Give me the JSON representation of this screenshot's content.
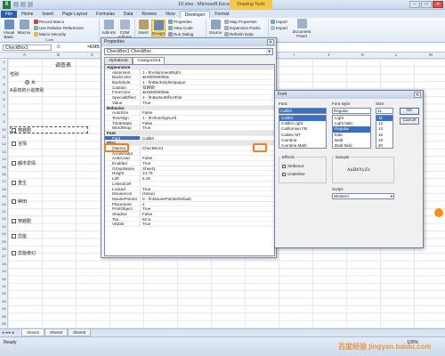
{
  "window": {
    "app_icon": "X",
    "title": "10.xlsx - Microsoft Excel",
    "context_tab": "Drawing Tools",
    "controls": [
      "–",
      "□",
      "✕"
    ]
  },
  "ribbon_tabs": [
    "File",
    "Home",
    "Insert",
    "Page Layout",
    "Formulas",
    "Data",
    "Review",
    "View",
    "Developer",
    "Format"
  ],
  "ribbon": {
    "visual_basic": "Visual Basic",
    "macros": "Macros",
    "record_macro": "Record Macro",
    "relative_refs": "Use Relative References",
    "macro_security": "Macro Security",
    "code_group": "Code",
    "add_ins": "Add-Ins",
    "com_add_ins": "COM Add-Ins",
    "insert": "Insert",
    "design": "Design",
    "properties": "Properties",
    "view_code": "View Code",
    "run_dialog": "Run Dialog",
    "source": "Source",
    "map_properties": "Map Properties",
    "expansion_packs": "Expansion Packs",
    "refresh_data": "Refresh Data",
    "import": "Import",
    "export": "Export",
    "document_panel": "Document Panel"
  },
  "formula_bar": {
    "name_box": "CheckBox1",
    "fx": "fx",
    "value": "=EMB"
  },
  "sheet": {
    "columns": [
      "A",
      "B",
      "C",
      "D",
      "E",
      "F",
      "G",
      "H",
      "I",
      "J",
      "K",
      "L",
      "M"
    ],
    "rows": [
      "1",
      "2",
      "3",
      "4",
      "5",
      "6",
      "7",
      "8",
      "9",
      "10",
      "11",
      "12",
      "13",
      "14",
      "15",
      "16",
      "17",
      "18",
      "19",
      "20",
      "21",
      "22",
      "23",
      "24",
      "25",
      "26",
      "27",
      "28",
      "29",
      "30",
      "31",
      "32",
      "33",
      "34",
      "35",
      "36"
    ],
    "title": "调查表",
    "gender_label": "性别",
    "radio_female": "女",
    "hobbies_prompt": "A喜欢的小说类别",
    "checkboxes": [
      "穿越剧",
      "言情",
      "都市爱情",
      "重生",
      "种田",
      "穿越剧",
      "异能",
      "异能奇幻"
    ]
  },
  "sheet_tabs": [
    "Sheet1",
    "Sheet2",
    "Sheet3"
  ],
  "status": {
    "ready": "Ready",
    "zoom": "100%"
  },
  "properties": {
    "title": "Properties",
    "object": "CheckBox1 CheckBox",
    "tabs": [
      "Alphabetic",
      "Categorized"
    ],
    "rows": [
      {
        "cat": "Appearance"
      },
      {
        "name": "Alignment",
        "value": "1 - fmAlignmentRight"
      },
      {
        "name": "BackColor",
        "value": "&H80000005&"
      },
      {
        "name": "BackStyle",
        "value": "1 - fmBackStyleOpaque"
      },
      {
        "name": "Caption",
        "value": "穿越剧"
      },
      {
        "name": "ForeColor",
        "value": "&H80000008&"
      },
      {
        "name": "SpecialEffect",
        "value": "2 - fmButtonEffectFlat"
      },
      {
        "name": "Value",
        "value": "True"
      },
      {
        "cat": "Behavior"
      },
      {
        "name": "AutoSize",
        "value": "False"
      },
      {
        "name": "TextAlign",
        "value": "1 - fmTextAlignLeft"
      },
      {
        "name": "TripleState",
        "value": "False"
      },
      {
        "name": "WordWrap",
        "value": "True"
      },
      {
        "cat": "Font"
      },
      {
        "name": "Font",
        "value": "Calibri",
        "sel": true
      },
      {
        "cat": "Misc"
      },
      {
        "name": "(Name)",
        "value": "CheckBox1"
      },
      {
        "name": "Accelerator",
        "value": ""
      },
      {
        "name": "AutoLoad",
        "value": "False"
      },
      {
        "name": "Enabled",
        "value": "True"
      },
      {
        "name": "GroupName",
        "value": "Sheet1"
      },
      {
        "name": "Height",
        "value": "24.75"
      },
      {
        "name": "Left",
        "value": "5.25"
      },
      {
        "name": "LinkedCell",
        "value": ""
      },
      {
        "name": "Locked",
        "value": "True"
      },
      {
        "name": "MouseIcon",
        "value": "(None)"
      },
      {
        "name": "MousePointer",
        "value": "0 - fmMousePointerDefault"
      },
      {
        "name": "Placement",
        "value": "2"
      },
      {
        "name": "PrintObject",
        "value": "True"
      },
      {
        "name": "Shadow",
        "value": "False"
      },
      {
        "name": "Top",
        "value": "82.5"
      },
      {
        "name": "Visible",
        "value": "True"
      }
    ],
    "ellipsis": "..."
  },
  "font_dialog": {
    "title": "Font",
    "font_label": "Font:",
    "font_value": "Calibri",
    "fonts": [
      "Calibri",
      "Calibri Light",
      "Californian FB",
      "Calisto MT",
      "Cambria",
      "Cambria Math"
    ],
    "style_label": "Font style:",
    "style_value": "Regular",
    "styles": [
      "Light",
      "Light Italic",
      "Regular",
      "Italic",
      "Bold",
      "Bold Italic"
    ],
    "size_label": "Size:",
    "size_value": "11",
    "sizes": [
      "11",
      "12",
      "14",
      "16",
      "18",
      "20",
      "22"
    ],
    "ok": "OK",
    "cancel": "Cancel",
    "effects_label": "Effects",
    "strikeout": "Strikeout",
    "underline": "Underline",
    "sample_label": "Sample",
    "sample_text": "AaBbYyZz",
    "script_label": "Script:",
    "script_value": "Western"
  },
  "watermark": "百度经验 jingyan.baidu.com",
  "colors": {
    "highlight": "#ff7a1a",
    "selection": "#3a6fc4",
    "file_tab": "#2a5ea8",
    "context_tab": "#f2c94c"
  }
}
